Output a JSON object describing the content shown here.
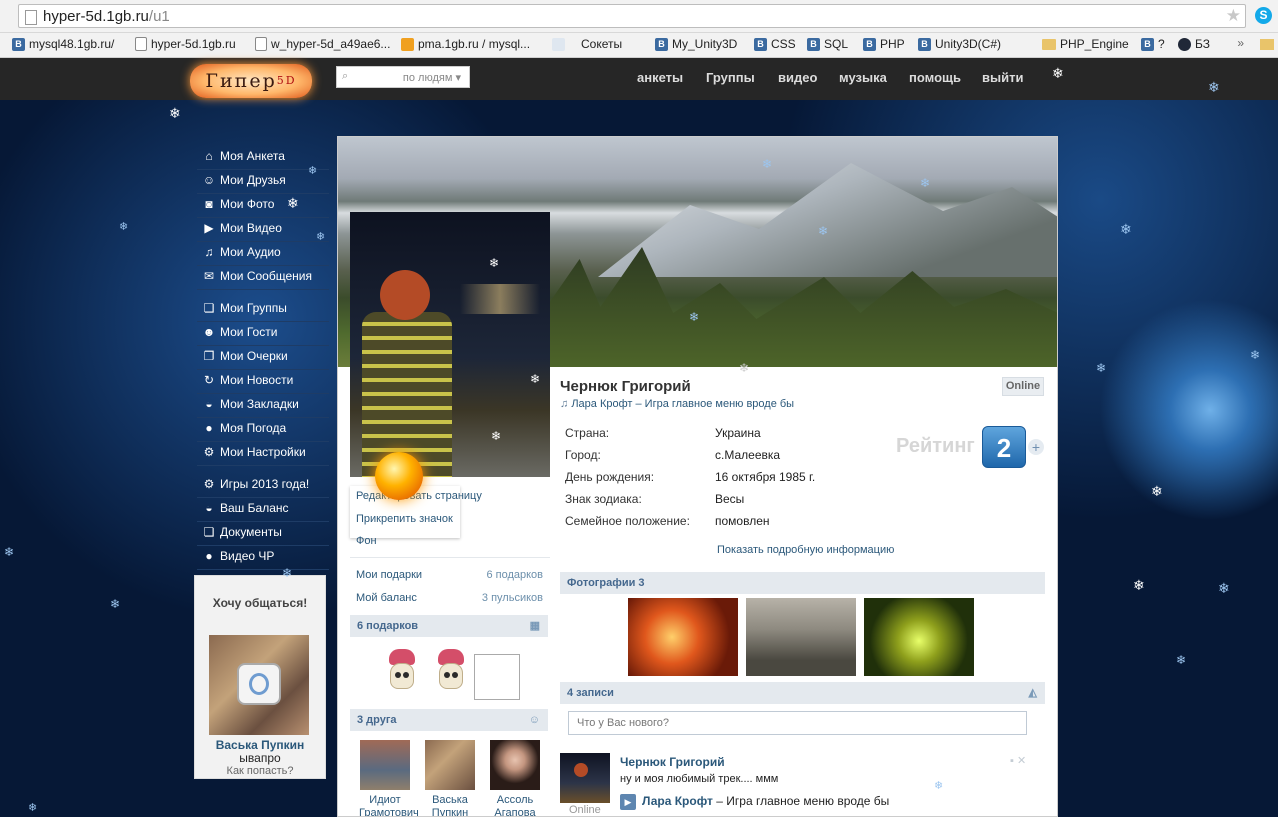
{
  "browser": {
    "url_host": "hyper-5d.1gb.ru",
    "url_path": "/u1",
    "star": "★",
    "skype": "S",
    "bookmarks": [
      {
        "label": "mysql48.1gb.ru/",
        "icon": "B"
      },
      {
        "label": "hyper-5d.1gb.ru",
        "icon": "page"
      },
      {
        "label": "w_hyper-5d_a49ae6...",
        "icon": "page"
      },
      {
        "label": "pma.1gb.ru / mysql...",
        "icon": "pma"
      },
      {
        "label": "Сокеты",
        "icon": "w"
      },
      {
        "label": "My_Unity3D",
        "icon": "B"
      },
      {
        "label": "CSS",
        "icon": "B"
      },
      {
        "label": "SQL",
        "icon": "B"
      },
      {
        "label": "PHP",
        "icon": "B"
      },
      {
        "label": "Unity3D(C#)",
        "icon": "B"
      },
      {
        "label": "PHP_Engine",
        "icon": "folder"
      },
      {
        "label": "?",
        "icon": "B"
      },
      {
        "label": "БЗ",
        "icon": "bz"
      }
    ],
    "more": "»"
  },
  "header": {
    "logo_text": "Гипер",
    "logo_sup": "5D",
    "search_placeholder": "по людям",
    "search_caret": "▾",
    "search_icon": "search-icon",
    "nav": [
      "анкеты",
      "Группы",
      "видео",
      "музыка",
      "помощь",
      "выйти"
    ]
  },
  "left_menu": [
    {
      "label": "Моя Анкета",
      "icon": "⌂"
    },
    {
      "label": "Мои Друзья",
      "icon": "☺"
    },
    {
      "label": "Мои Фото",
      "icon": "◙"
    },
    {
      "label": "Мои Видео",
      "icon": "▶"
    },
    {
      "label": "Мои Аудио",
      "icon": "♫"
    },
    {
      "label": "Мои Сообщения",
      "icon": "✉"
    },
    {
      "label": "Мои Группы",
      "icon": "❏"
    },
    {
      "label": "Мои Гости",
      "icon": "☻"
    },
    {
      "label": "Мои Очерки",
      "icon": "❐"
    },
    {
      "label": "Мои Новости",
      "icon": "↻"
    },
    {
      "label": "Мои Закладки",
      "icon": "◒"
    },
    {
      "label": "Моя Погода",
      "icon": "●"
    },
    {
      "label": "Мои Настройки",
      "icon": "⚙"
    },
    {
      "label": "Игры 2013 года!",
      "icon": "⚙"
    },
    {
      "label": "Ваш Баланс",
      "icon": "◒"
    },
    {
      "label": "Документы",
      "icon": "❏"
    },
    {
      "label": "Видео ЧР",
      "icon": "●"
    }
  ],
  "promo": {
    "title": "Хочу общаться!",
    "name": "Васька Пупкин",
    "sub": "ывапро",
    "how": "Как попасть?"
  },
  "profile": {
    "name": "Чернюк Григорий",
    "online": "Online",
    "status_note": "♫",
    "status": "Лара Крофт – Игра главное меню вроде бы",
    "info": [
      {
        "key": "Страна:",
        "value": "Украина"
      },
      {
        "key": "Город:",
        "value": "с.Малеевка"
      },
      {
        "key": "День рождения:",
        "value": "16 октября 1985 г."
      },
      {
        "key": "Знак зодиака:",
        "value": "Весы"
      },
      {
        "key": "Семейное положение:",
        "value": "помовлен"
      }
    ],
    "rating_label": "Рейтинг",
    "rating_value": "2",
    "rating_plus": "+",
    "show_more": "Показать подробную информацию"
  },
  "left_column": {
    "dropdown": [
      "Редактировать страницу",
      "Прикрепить значок",
      "Фон"
    ],
    "gifts_link": "Мои подарки",
    "gifts_count": "6 подарков",
    "balance_link": "Мой баланс",
    "balance_count": "3 пульсиков",
    "gifts_header": "6 подарков",
    "friends_header": "3 друга",
    "friends": [
      {
        "name_l1": "Идиот",
        "name_l2": "Грамотович"
      },
      {
        "name_l1": "Васька",
        "name_l2": "Пупкин"
      },
      {
        "name_l1": "Ассоль",
        "name_l2": "Агапова"
      }
    ]
  },
  "photos_header": "Фотографии 3",
  "wall": {
    "header": "4 записи",
    "placeholder": "Что у Вас нового?",
    "post": {
      "author": "Чернюк Григорий",
      "text": "ну и моя любимый трек.... ммм",
      "track_artist": "Лара Крофт",
      "track_rest": " – Игра главное меню вроде бы",
      "online": "Online",
      "play": "▶",
      "tools": "▪ ✕"
    }
  },
  "colors": {
    "accent": "#2b587a",
    "header_bg": "#262626",
    "section_bg": "#e4e9ee",
    "rating": "#2a74b8"
  }
}
